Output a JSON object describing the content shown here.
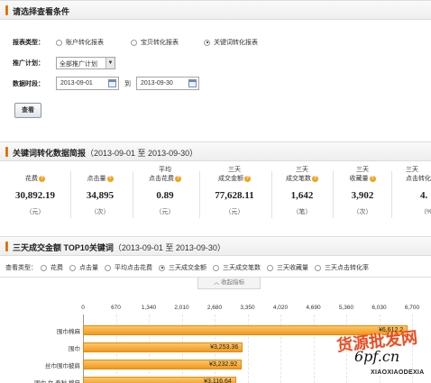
{
  "query_section": {
    "title": "请选择查看条件",
    "report_type_label": "报表类型：",
    "report_types": [
      "账户转化报表",
      "宝贝转化报表",
      "关键词转化报表"
    ],
    "selected_report_type": 2,
    "plan_label": "推广计划：",
    "plan_value": "全部推广计划",
    "period_label": "数据时段：",
    "start_date": "2013-09-01",
    "to_label": "到",
    "end_date": "2013-09-30",
    "view_button": "查看"
  },
  "summary_section": {
    "title": "关键词转化数据简报",
    "range": "（2013-09-01 至 2013-09-30）",
    "metrics": [
      {
        "name": "花费",
        "value": "30,892.19",
        "unit": "（元）"
      },
      {
        "name": "点击量",
        "value": "34,895",
        "unit": "（次）"
      },
      {
        "name": "平均\n点击花费",
        "value": "0.89",
        "unit": "（元）"
      },
      {
        "name": "三天\n成交金额",
        "value": "77,628.11",
        "unit": "（元）"
      },
      {
        "name": "三天\n成交笔数",
        "value": "1,642",
        "unit": "（笔）"
      },
      {
        "name": "三天\n收藏量",
        "value": "3,902",
        "unit": "（次）"
      },
      {
        "name": "三天\n点击转化",
        "value": "4.",
        "unit": "（%"
      }
    ]
  },
  "top10_section": {
    "title": "三天成交金额 TOP10关键词",
    "range": "（2013-09-01 至 2013-09-30）",
    "view_type_label": "查看类型：",
    "view_types": [
      "花费",
      "点击量",
      "平均点击花费",
      "三天成交金额",
      "三天成交笔数",
      "三天收藏量",
      "三天点击转化率"
    ],
    "selected_view_type": 3,
    "collapse_label": "︿ 收起指标"
  },
  "chart_data": {
    "type": "bar",
    "orientation": "horizontal",
    "categories": [
      "围巾棉麻",
      "围巾",
      "丝巾围巾披肩",
      "围巾 女 春秋 棉麻"
    ],
    "values": [
      6612.2,
      3253.36,
      3232.92,
      3116.64
    ],
    "value_labels": [
      "¥6,612.2",
      "¥3,253.36",
      "¥3,232.92",
      "¥3,116.64"
    ],
    "ticks": [
      "0",
      "670",
      "1,340",
      "2,010",
      "2,680",
      "3,350",
      "4,020",
      "4,690",
      "5,360",
      "6,030",
      "6,700"
    ],
    "xlim": [
      0,
      6700
    ],
    "grid": true,
    "color": "#f4a62a"
  },
  "watermark": {
    "line1": "货源批发网",
    "line2": "6pf.cn",
    "line3": "XIAOXIAODEXIA"
  },
  "colors": {
    "accent": "#e8521a",
    "help_icon": "#f0a419"
  }
}
